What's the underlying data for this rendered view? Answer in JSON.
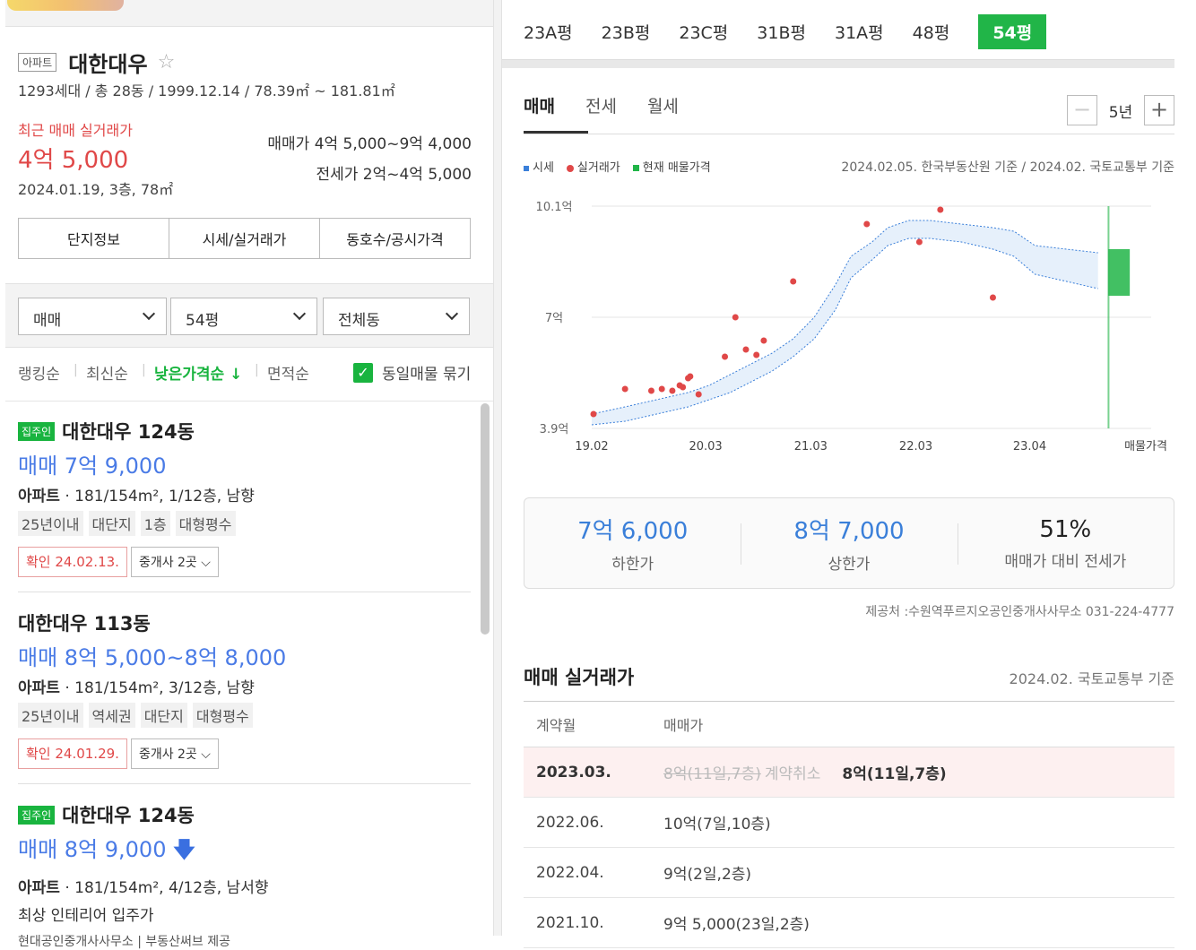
{
  "complex": {
    "type_badge": "아파트",
    "name": "대한대우",
    "star": "☆",
    "meta": "1293세대 / 총 28동 / 1999.12.14 / 78.39㎡ ~ 181.81㎡",
    "recent_label": "최근 매매 실거래가",
    "recent_price": "4억 5,000",
    "recent_date": "2024.01.19, 3층, 78㎡",
    "sale_range": "매매가 4억 5,000~9억 4,000",
    "jeonse_range": "전세가 2억~4억 5,000"
  },
  "info_tabs": [
    "단지정보",
    "시세/실거래가",
    "동호수/공시가격"
  ],
  "filters": {
    "trade": "매매",
    "size": "54평",
    "dong": "전체동"
  },
  "sort": {
    "items": [
      "랭킹순",
      "최신순",
      "낮은가격순 ↓",
      "면적순"
    ],
    "active_index": 2,
    "check_mark": "✓",
    "group_label": "동일매물 묶기"
  },
  "listings": [
    {
      "badge": "집주인",
      "title": "대한대우 124동",
      "price": "매매 7억 9,000",
      "spec_type": "아파트",
      "spec": " · 181/154m², 1/12층, 남향",
      "tags": [
        "25년이내",
        "대단지",
        "1층",
        "대형평수"
      ],
      "confirm": "확인 24.02.13.",
      "broker": "중개사 2곳 ⌵"
    },
    {
      "badge": "",
      "title": "대한대우 113동",
      "price": "매매 8억 5,000~8억 8,000",
      "spec_type": "아파트",
      "spec": " · 181/154m², 3/12층, 남향",
      "tags": [
        "25년이내",
        "역세권",
        "대단지",
        "대형평수"
      ],
      "confirm": "확인 24.01.29.",
      "broker": "중개사 2곳 ⌵"
    },
    {
      "badge": "집주인",
      "title": "대한대우 124동",
      "price": "매매 8억 9,000",
      "price_arrow": "🡇",
      "spec_type": "아파트",
      "spec": " · 181/154m², 4/12층, 남서향",
      "desc": "최상 인테리어 입주가",
      "meta": "현대공인중개사사무소 | 부동산써브 제공"
    }
  ],
  "size_tabs": [
    "23A평",
    "23B평",
    "23C평",
    "31B평",
    "31A평",
    "48평",
    "54평"
  ],
  "size_active_index": 6,
  "trade_tabs": [
    "매매",
    "전세",
    "월세"
  ],
  "year_control": {
    "minus": "−",
    "label": "5년",
    "plus": "+"
  },
  "legend": {
    "market": "시세",
    "actual": "실거래가",
    "listing": "현재 매물가격",
    "basis": "2024.02.05. 한국부동산원 기준 / 2024.02. 국토교통부 기준"
  },
  "colors": {
    "accent_green": "#21b548",
    "price_blue": "#3a7fd9",
    "alert_red": "#e04848",
    "band_fill": "#e6f0fb"
  },
  "chart_data": {
    "type": "line",
    "ylabels": [
      "10.1억",
      "7억",
      "3.9억"
    ],
    "yticks": [
      10.1,
      7,
      3.9
    ],
    "ylim": [
      3.9,
      10.1
    ],
    "xlabels": [
      "19.02",
      "20.03",
      "21.03",
      "22.03",
      "23.04",
      "매물가격"
    ],
    "xticks": [
      2019.083,
      2020.167,
      2021.167,
      2022.167,
      2023.25
    ],
    "xlim": [
      2019.083,
      2024.167
    ],
    "grid": true,
    "band": {
      "x": [
        2019.083,
        2019.4,
        2019.7,
        2020.0,
        2020.2,
        2020.4,
        2020.6,
        2020.8,
        2021.0,
        2021.2,
        2021.4,
        2021.55,
        2021.75,
        2021.9,
        2022.1,
        2022.3,
        2022.6,
        2022.9,
        2023.1,
        2023.3,
        2023.6,
        2023.9
      ],
      "upper": [
        4.3,
        4.5,
        4.7,
        4.9,
        5.1,
        5.4,
        5.7,
        6.0,
        6.4,
        7.0,
        7.9,
        8.7,
        9.1,
        9.5,
        9.7,
        9.7,
        9.6,
        9.5,
        9.4,
        9.0,
        8.9,
        8.8
      ],
      "lower": [
        4.0,
        4.1,
        4.3,
        4.5,
        4.7,
        4.9,
        5.2,
        5.5,
        5.9,
        6.4,
        7.2,
        8.1,
        8.6,
        9.0,
        9.2,
        9.2,
        9.1,
        8.9,
        8.7,
        8.2,
        8.0,
        7.8
      ]
    },
    "actual_points": [
      {
        "x": 2019.1,
        "y": 4.3
      },
      {
        "x": 2019.4,
        "y": 5.0
      },
      {
        "x": 2019.65,
        "y": 4.95
      },
      {
        "x": 2019.75,
        "y": 5.0
      },
      {
        "x": 2019.85,
        "y": 4.95
      },
      {
        "x": 2019.92,
        "y": 5.1
      },
      {
        "x": 2019.95,
        "y": 5.05
      },
      {
        "x": 2020.0,
        "y": 5.3
      },
      {
        "x": 2020.02,
        "y": 5.35
      },
      {
        "x": 2020.1,
        "y": 4.85
      },
      {
        "x": 2020.35,
        "y": 5.9
      },
      {
        "x": 2020.45,
        "y": 7.0
      },
      {
        "x": 2020.55,
        "y": 6.1
      },
      {
        "x": 2020.65,
        "y": 5.95
      },
      {
        "x": 2020.72,
        "y": 6.35
      },
      {
        "x": 2021.0,
        "y": 8.0
      },
      {
        "x": 2021.7,
        "y": 9.6
      },
      {
        "x": 2022.2,
        "y": 9.1
      },
      {
        "x": 2022.4,
        "y": 10.0
      },
      {
        "x": 2022.9,
        "y": 7.55
      }
    ],
    "listing_range": {
      "x": 2024.1,
      "low": 7.6,
      "high": 8.9
    },
    "listing_line_x": 2024.0
  },
  "summary": [
    {
      "value": "7억 6,000",
      "label": "하한가"
    },
    {
      "value": "8억 7,000",
      "label": "상한가"
    },
    {
      "value": "51%",
      "label": "매매가 대비 전세가"
    }
  ],
  "provider": "제공처 :수원역푸르지오공인중개사사무소 031-224-4777",
  "records": {
    "title": "매매 실거래가",
    "basis": "2024.02. 국토교통부 기준",
    "headers": [
      "계약월",
      "매매가"
    ],
    "rows": [
      {
        "month": "2023.03.",
        "cancelled": "8억(11일,7층)",
        "cancel_label": "계약취소",
        "price": "8억(11일,7층)"
      },
      {
        "month": "2022.06.",
        "price": "10억(7일,10층)"
      },
      {
        "month": "2022.04.",
        "price": "9억(2일,2층)"
      },
      {
        "month": "2021.10.",
        "price": "9억 5,000(23일,2층)"
      }
    ]
  }
}
